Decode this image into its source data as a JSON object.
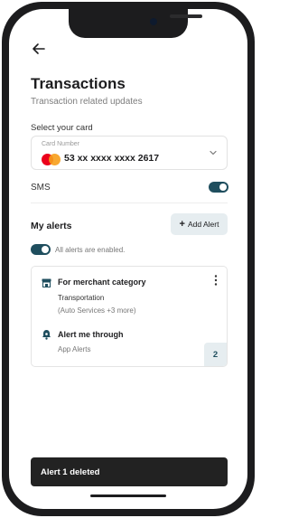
{
  "header": {
    "title": "Transactions",
    "subtitle": "Transaction related updates"
  },
  "card_select": {
    "label": "Select your card",
    "caption": "Card Number",
    "number": "53 xx xxxx xxxx 2617",
    "brand_icon": "mastercard-icon"
  },
  "sms": {
    "label": "SMS",
    "enabled": true
  },
  "alerts": {
    "title": "My alerts",
    "add_button_label": "Add Alert",
    "all_enabled_text": "All alerts are enabled.",
    "all_enabled": true,
    "items": [
      {
        "trigger_title": "For merchant category",
        "category": "Transportation",
        "category_more": "(Auto Services +3 more)",
        "through_title": "Alert me through",
        "through_value": "App Alerts",
        "count": "2"
      }
    ]
  },
  "snackbar": {
    "message": "Alert 1 deleted"
  },
  "colors": {
    "accent": "#1f4e5e",
    "button_bg": "#e6edf0",
    "snackbar_bg": "#222222"
  }
}
